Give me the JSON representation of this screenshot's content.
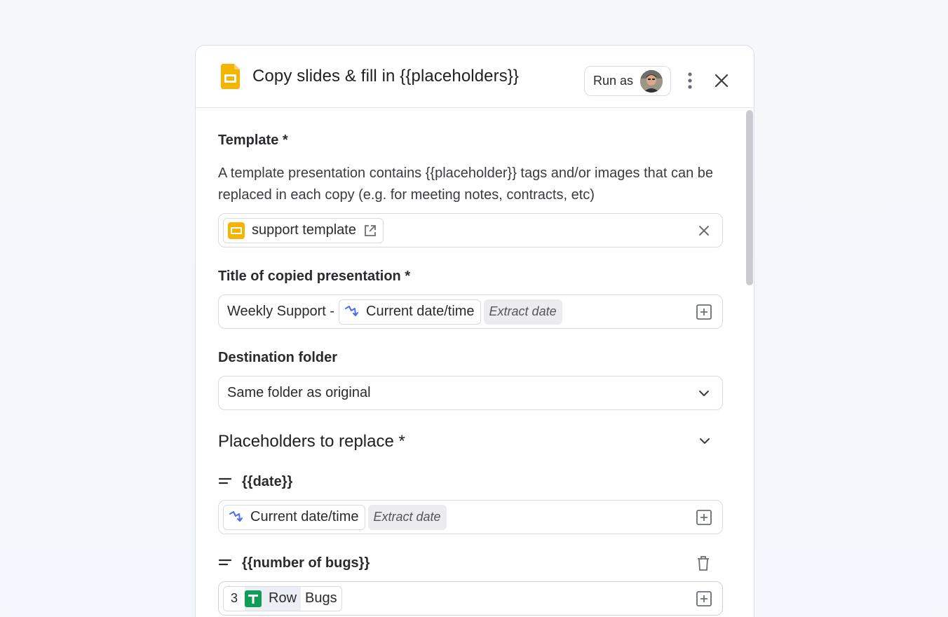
{
  "header": {
    "title": "Copy slides & fill in {{placeholders}}",
    "run_as_label": "Run as"
  },
  "template": {
    "label": "Template *",
    "description": "A template presentation contains {{placeholder}} tags and/or images that can be replaced in each copy (e.g. for meeting notes, contracts, etc)",
    "selected": "support template"
  },
  "title_field": {
    "label": "Title of copied presentation *",
    "prefix": "Weekly Support -",
    "token": "Current date/time",
    "modifier": "Extract date"
  },
  "destination": {
    "label": "Destination folder",
    "value": "Same folder as original"
  },
  "placeholders": {
    "section_title": "Placeholders to replace *",
    "items": [
      {
        "name": "{{date}}",
        "token": "Current date/time",
        "modifier": "Extract date"
      },
      {
        "name": "{{number of bugs}}",
        "step_number": "3",
        "row_label": "Row",
        "column": "Bugs"
      }
    ]
  },
  "colors": {
    "slides_yellow": "#F4B400",
    "sheets_green": "#0F9D58",
    "token_blue": "#4a6cf7"
  },
  "icons": [
    "slides-icon",
    "more-vert-icon",
    "close-icon",
    "external-link-icon",
    "clear-icon",
    "variable-icon",
    "add-box-icon",
    "chevron-down-icon",
    "drag-handle-icon",
    "trash-icon",
    "sheets-icon"
  ]
}
